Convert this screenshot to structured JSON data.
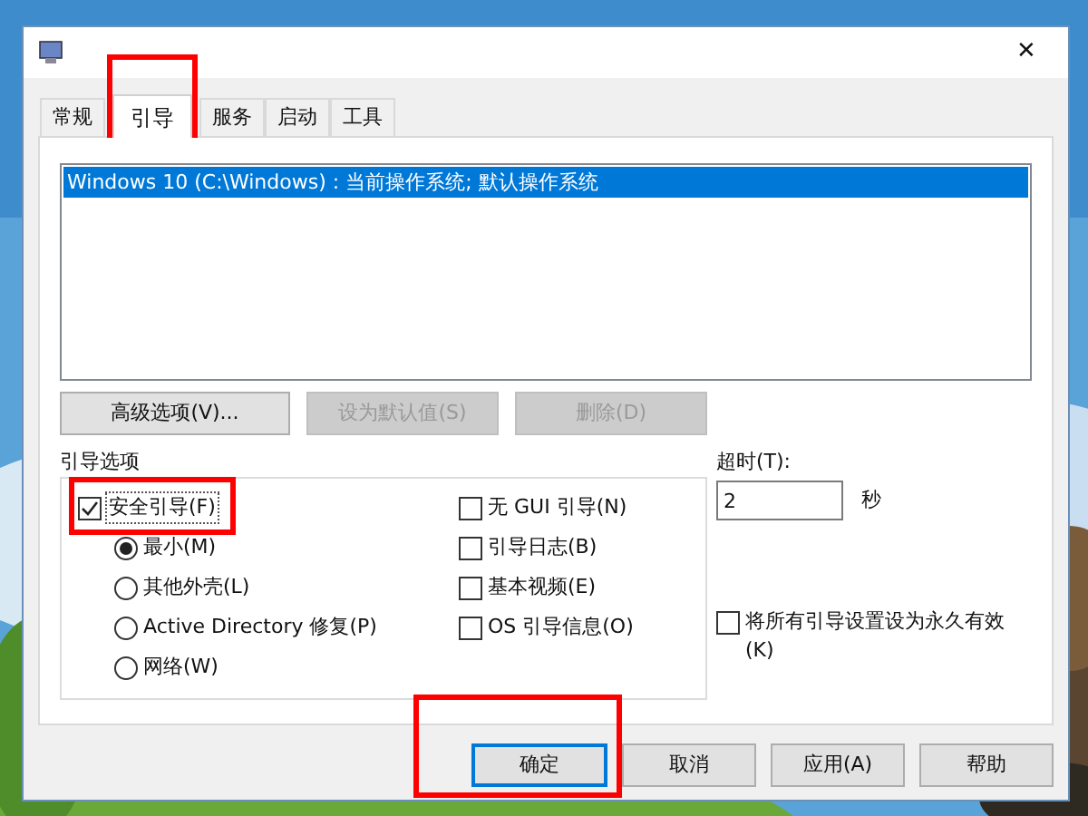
{
  "window": {
    "close": "✕"
  },
  "tabs": [
    {
      "label": "常规",
      "selected": false
    },
    {
      "label": "引导",
      "selected": true
    },
    {
      "label": "服务",
      "selected": false
    },
    {
      "label": "启动",
      "selected": false
    },
    {
      "label": "工具",
      "selected": false
    }
  ],
  "boot_list": [
    {
      "text": "Windows 10 (C:\\Windows) : 当前操作系统; 默认操作系统",
      "selected": true
    }
  ],
  "list_buttons": [
    {
      "label": "高级选项(V)...",
      "disabled": false
    },
    {
      "label": "设为默认值(S)",
      "disabled": true
    },
    {
      "label": "删除(D)",
      "disabled": true
    }
  ],
  "boot_options": {
    "title": "引导选项",
    "safe_boot": {
      "label": "安全引导(F)",
      "checked": true
    },
    "modes": [
      {
        "label": "最小(M)",
        "selected": true
      },
      {
        "label": "其他外壳(L)",
        "selected": false
      },
      {
        "label": "Active Directory 修复(P)",
        "selected": false
      },
      {
        "label": "网络(W)",
        "selected": false
      }
    ],
    "flags": [
      {
        "label": "无 GUI 引导(N)",
        "checked": false
      },
      {
        "label": "引导日志(B)",
        "checked": false
      },
      {
        "label": "基本视频(E)",
        "checked": false
      },
      {
        "label": "OS 引导信息(O)",
        "checked": false
      }
    ]
  },
  "timeout": {
    "label": "超时(T):",
    "value": "2",
    "unit": "秒"
  },
  "permanent": {
    "label": "将所有引导设置设为永久有效",
    "label_line2": "(K)",
    "checked": false
  },
  "buttons": [
    {
      "label": "确定",
      "default": true
    },
    {
      "label": "取消",
      "default": false
    },
    {
      "label": "应用(A)",
      "default": false
    },
    {
      "label": "帮助",
      "default": false
    }
  ],
  "highlights": [
    {
      "kind": "tab"
    },
    {
      "kind": "safe_boot"
    },
    {
      "kind": "ok_button"
    }
  ]
}
